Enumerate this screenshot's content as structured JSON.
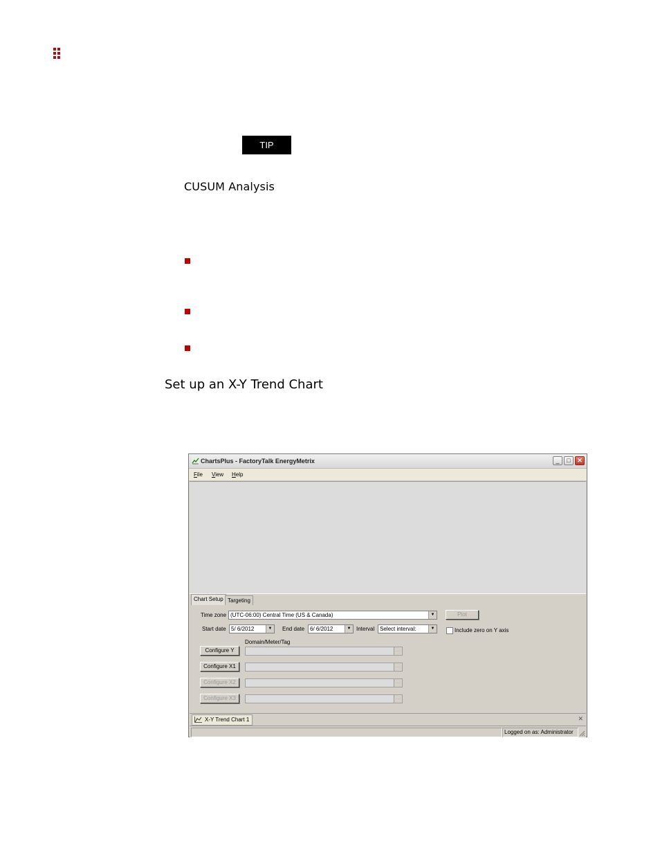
{
  "tip": {
    "label": "TIP"
  },
  "subheading": "CUSUM Analysis",
  "section_title": "Set up an X-Y Trend Chart",
  "window": {
    "title": "ChartsPlus - FactoryTalk EnergyMetrix",
    "controls": {
      "minimize": "_",
      "maximize": "□",
      "close": "✕"
    },
    "menu": [
      "File",
      "View",
      "Help"
    ],
    "tabs": [
      {
        "label": "Chart Setup",
        "active": true
      },
      {
        "label": "Targeting",
        "active": false
      }
    ],
    "form": {
      "time_zone_label": "Time zone",
      "time_zone_value": "(UTC-06:00) Central Time (US & Canada)",
      "plot_label": "Plot",
      "start_date_label": "Start date",
      "start_date_value": "5/ 6/2012",
      "end_date_label": "End date",
      "end_date_value": "6/ 6/2012",
      "interval_label": "Interval",
      "interval_value": "Select interval:",
      "include_zero_label": "Include zero on Y axis",
      "domain_header": "Domain/Meter/Tag",
      "configure_buttons": [
        "Configure Y",
        "Configure X1",
        "Configure X2",
        "Configure X3"
      ]
    },
    "doc_tab": "X-Y Trend Chart 1",
    "doc_close": "✕",
    "status": "Logged on as: Administrator"
  },
  "colors": {
    "accent": "#c00000",
    "window_face": "#d4d0c8"
  }
}
